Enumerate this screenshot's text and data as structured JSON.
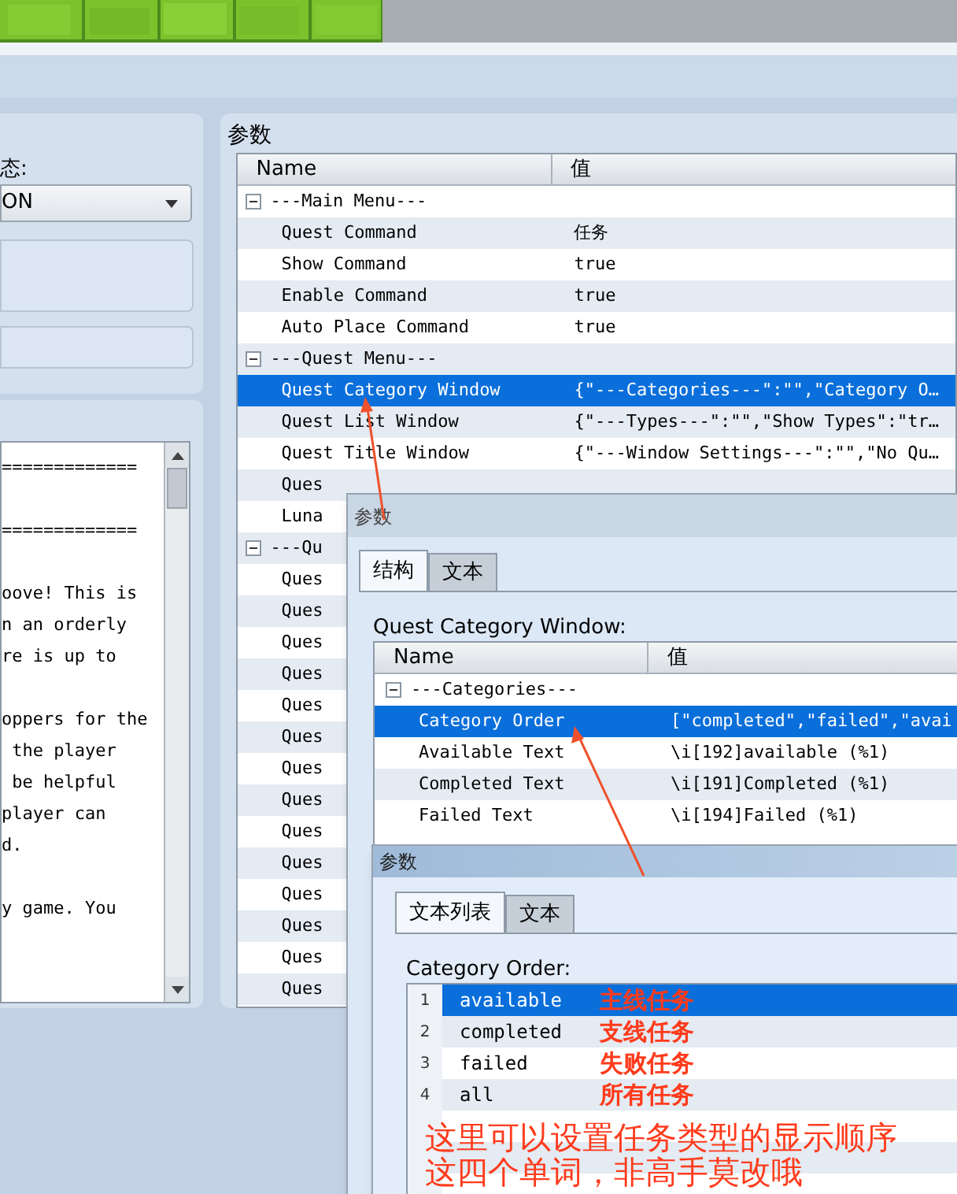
{
  "left_panel": {
    "state_label": "态:",
    "dropdown": {
      "value": "ON"
    }
  },
  "description": {
    "paragraphs": [
      [
        "============="
      ],
      [
        "============="
      ],
      [
        "oove! This is",
        "n an orderly",
        "re is up to"
      ],
      [
        "oppers for the",
        " the player",
        " be helpful",
        "player can",
        "d."
      ],
      [
        "y game. You"
      ]
    ]
  },
  "parameters": {
    "title": "参数",
    "columns": [
      "Name",
      "值"
    ],
    "rows": [
      {
        "kind": "group",
        "name": "---Main Menu---",
        "expanded": true,
        "selected": false
      },
      {
        "kind": "item",
        "name": "Quest Command",
        "value": "任务",
        "selected": false
      },
      {
        "kind": "item",
        "name": "Show Command",
        "value": "true",
        "selected": false
      },
      {
        "kind": "item",
        "name": "Enable Command",
        "value": "true",
        "selected": false
      },
      {
        "kind": "item",
        "name": "Auto Place Command",
        "value": "true",
        "selected": false
      },
      {
        "kind": "group",
        "name": "---Quest Menu---",
        "expanded": true,
        "selected": false
      },
      {
        "kind": "item",
        "name": "Quest Category Window",
        "value": "{\"---Categories---\":\"\",\"Category O…",
        "selected": true
      },
      {
        "kind": "item",
        "name": "Quest List Window",
        "value": "{\"---Types---\":\"\",\"Show Types\":\"tr…",
        "selected": false
      },
      {
        "kind": "item",
        "name": "Quest Title Window",
        "value": "{\"---Window Settings---\":\"\",\"No Qu…",
        "selected": false
      },
      {
        "kind": "item",
        "name": "Ques",
        "selected": false
      },
      {
        "kind": "item",
        "name": "Luna",
        "selected": false
      },
      {
        "kind": "group",
        "name": "---Qu",
        "expanded": true,
        "selected": false
      },
      {
        "kind": "item",
        "name": "Ques",
        "selected": false
      },
      {
        "kind": "item",
        "name": "Ques",
        "selected": false
      },
      {
        "kind": "item",
        "name": "Ques",
        "selected": false
      },
      {
        "kind": "item",
        "name": "Ques",
        "selected": false
      },
      {
        "kind": "item",
        "name": "Ques",
        "selected": false
      },
      {
        "kind": "item",
        "name": "Ques",
        "selected": false
      },
      {
        "kind": "item",
        "name": "Ques",
        "selected": false
      },
      {
        "kind": "item",
        "name": "Ques",
        "selected": false
      },
      {
        "kind": "item",
        "name": "Ques",
        "selected": false
      },
      {
        "kind": "item",
        "name": "Ques",
        "selected": false
      },
      {
        "kind": "item",
        "name": "Ques",
        "selected": false
      },
      {
        "kind": "item",
        "name": "Ques",
        "selected": false
      },
      {
        "kind": "item",
        "name": "Ques",
        "selected": false
      },
      {
        "kind": "item",
        "name": "Ques",
        "selected": false
      }
    ]
  },
  "structure_dialog": {
    "title": "参数",
    "tabs": [
      {
        "label": "结构",
        "selected": true
      },
      {
        "label": "文本",
        "selected": false
      }
    ],
    "label": "Quest Category Window:",
    "columns": [
      "Name",
      "值"
    ],
    "rows": [
      {
        "kind": "group",
        "name": "---Categories---",
        "expanded": true,
        "selected": false
      },
      {
        "kind": "item",
        "name": "Category Order",
        "value": "[\"completed\",\"failed\",\"avai",
        "selected": true
      },
      {
        "kind": "item",
        "name": "Available Text",
        "value": "\\i[192]available (%1)",
        "selected": false
      },
      {
        "kind": "item",
        "name": "Completed Text",
        "value": "\\i[191]Completed (%1)",
        "selected": false
      },
      {
        "kind": "item",
        "name": "Failed Text",
        "value": "\\i[194]Failed (%1)",
        "selected": false
      }
    ]
  },
  "list_dialog": {
    "title": "参数",
    "tabs": [
      {
        "label": "文本列表",
        "selected": true
      },
      {
        "label": "文本",
        "selected": false
      }
    ],
    "label": "Category Order:",
    "items": [
      {
        "number": "1",
        "text": "available",
        "note": "主线任务",
        "selected": true
      },
      {
        "number": "2",
        "text": "completed",
        "note": "支线任务",
        "selected": false
      },
      {
        "number": "3",
        "text": "failed",
        "note": "失败任务",
        "selected": false
      },
      {
        "number": "4",
        "text": "all",
        "note": "所有任务",
        "selected": false
      }
    ]
  },
  "annotation": {
    "lines": [
      "这里可以设置任务类型的显示顺序",
      "这四个单词，非高手莫改哦"
    ]
  }
}
